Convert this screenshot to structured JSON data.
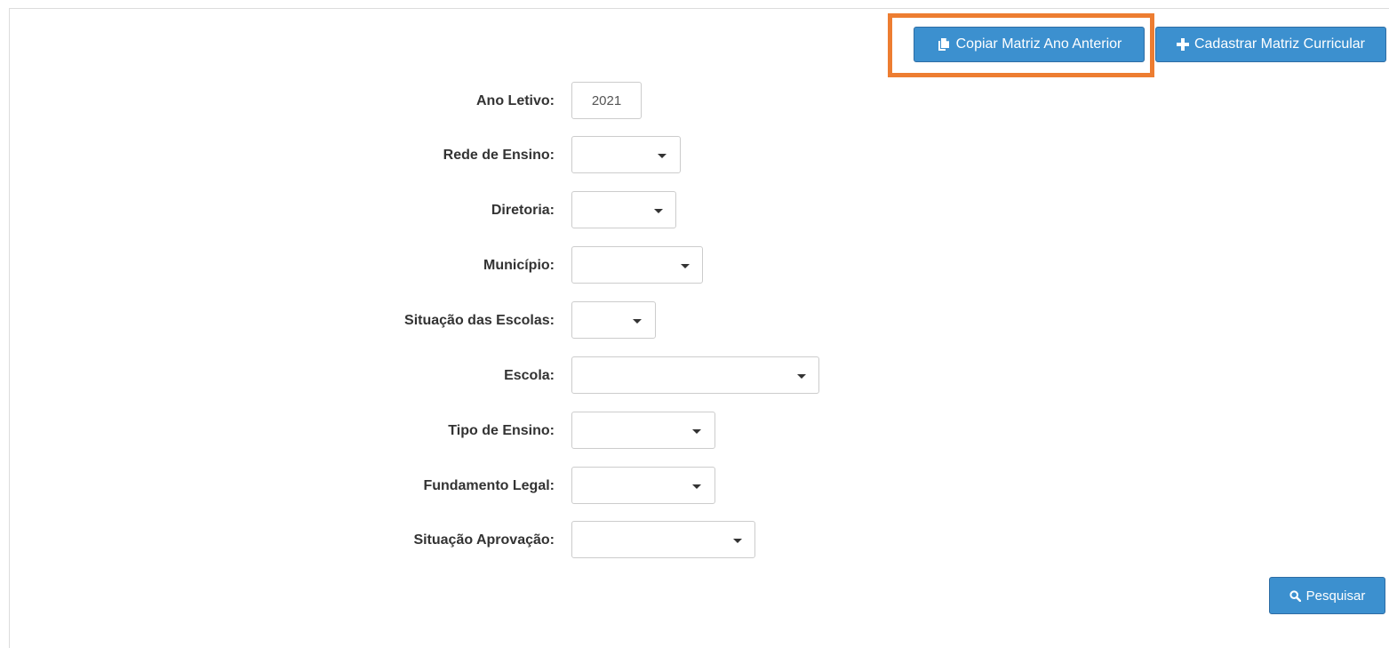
{
  "toolbar": {
    "copy_label": "Copiar Matriz Ano Anterior",
    "add_label": "Cadastrar Matriz Curricular",
    "copy_icon": "copy-icon",
    "add_icon": "plus-icon",
    "highlight_color": "#ed7d31",
    "button_color": "#3c90cf"
  },
  "form": {
    "ano_letivo": {
      "label": "Ano Letivo:",
      "value": "2021"
    },
    "rede_ensino": {
      "label": "Rede de Ensino:",
      "value": ""
    },
    "diretoria": {
      "label": "Diretoria:",
      "value": ""
    },
    "municipio": {
      "label": "Município:",
      "value": ""
    },
    "situacao_escolas": {
      "label": "Situação das Escolas:",
      "value": ""
    },
    "escola": {
      "label": "Escola:",
      "value": ""
    },
    "tipo_ensino": {
      "label": "Tipo de Ensino:",
      "value": ""
    },
    "fundamento_legal": {
      "label": "Fundamento Legal:",
      "value": ""
    },
    "situacao_aprovacao": {
      "label": "Situação Aprovação:",
      "value": ""
    }
  },
  "actions": {
    "search_label": "Pesquisar",
    "search_icon": "search-icon"
  }
}
